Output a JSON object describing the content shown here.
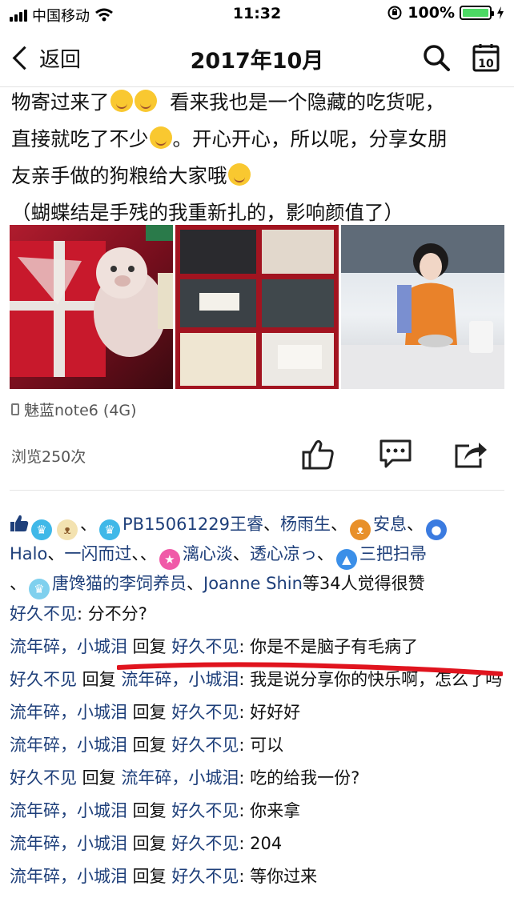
{
  "status_bar": {
    "carrier": "中国移动",
    "time": "11:32",
    "battery": "100%"
  },
  "nav": {
    "back_label": "返回",
    "title": "2017年10月",
    "calendar_day": "10"
  },
  "post": {
    "lines": [
      "物寄过来了",
      "看来我也是一个隐藏的吃货呢，",
      "直接就吃了不少",
      "。开心开心，所以呢，分享女朋",
      "友亲手做的狗粮给大家哦",
      "（蝴蝶结是手残的我重新扎的，影响颜值了）"
    ],
    "photos": [
      {
        "alt": "红色礼盒与小猪玩偶"
      },
      {
        "alt": "礼盒内包装好的狗粮"
      },
      {
        "alt": "女孩在厨房制作"
      }
    ],
    "device": "魅蓝note6 (4G)",
    "views": "浏览250次"
  },
  "likes": {
    "sep1": "、",
    "user_1": "PB15061229王睿",
    "user_2": "杨雨生",
    "user_3": "安息",
    "user_4": "Halo",
    "user_5": "一闪而过",
    "sep2": "、",
    "user_6": "漓心淡",
    "user_7": "透心凉っ",
    "user_8": "三把扫帚",
    "sep3": "、",
    "user_9": "唐馋猫的李饲养员",
    "user_10": "Joanne Shin",
    "suffix": "等34人觉得很赞"
  },
  "comments": [
    {
      "from": "好久不见",
      "reply_word": "",
      "to": "",
      "text": ": 分不分?"
    },
    {
      "from": "流年碎，小城泪",
      "reply_word": " 回复 ",
      "to": "好久不见",
      "text": ": 你是不是脑子有毛病了"
    },
    {
      "from": "好久不见",
      "reply_word": " 回复 ",
      "to": "流年碎，小城泪",
      "text": ": 我是说分享你的快乐啊，怎么了吗"
    },
    {
      "from": "流年碎，小城泪",
      "reply_word": " 回复 ",
      "to": "好久不见",
      "text": ": 好好好"
    },
    {
      "from": "流年碎，小城泪",
      "reply_word": " 回复 ",
      "to": "好久不见",
      "text": ": 可以"
    },
    {
      "from": "好久不见",
      "reply_word": " 回复 ",
      "to": "流年碎，小城泪",
      "text": ": 吃的给我一份?"
    },
    {
      "from": "流年碎，小城泪",
      "reply_word": " 回复 ",
      "to": "好久不见",
      "text": ": 你来拿"
    },
    {
      "from": "流年碎，小城泪",
      "reply_word": " 回复 ",
      "to": "好久不见",
      "text": ": 204"
    },
    {
      "from": "流年碎，小城泪",
      "reply_word": " 回复 ",
      "to": "好久不见",
      "text": ": 等你过来"
    }
  ],
  "colors": {
    "link_name": "#1e3f7a",
    "annotation_red": "#e0141e",
    "battery_green": "#4cd964"
  }
}
